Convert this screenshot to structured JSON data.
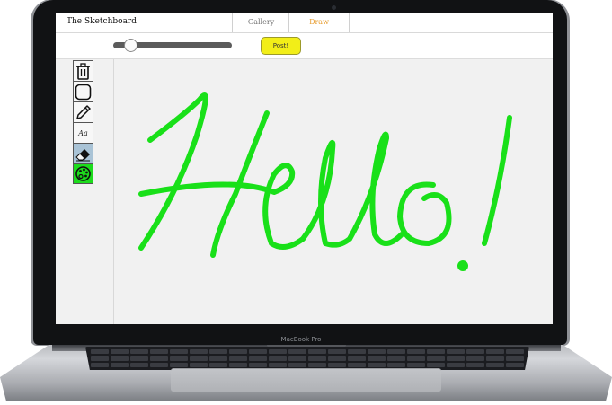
{
  "app": {
    "brand": "The Sketchboard",
    "tabs": [
      {
        "label": "Gallery",
        "active": false
      },
      {
        "label": "Draw",
        "active": true
      }
    ],
    "active_tab_color": "#e79b2c"
  },
  "controls": {
    "brush_size_fraction": 0.1,
    "post_label": "Post!",
    "post_color": "#f2ee18"
  },
  "tools": [
    {
      "name": "trash",
      "icon": "trash-icon"
    },
    {
      "name": "shape",
      "icon": "rounded-square-icon"
    },
    {
      "name": "pencil",
      "icon": "pencil-icon"
    },
    {
      "name": "text",
      "icon": "text-icon",
      "label": "Aa"
    },
    {
      "name": "eraser",
      "icon": "eraser-icon",
      "selected": true
    },
    {
      "name": "color",
      "icon": "palette-icon",
      "color": "#1ddc1d"
    }
  ],
  "drawing": {
    "handwritten_text": "Hello!",
    "stroke_color": "#19e019"
  },
  "device": {
    "label": "MacBook Pro"
  }
}
